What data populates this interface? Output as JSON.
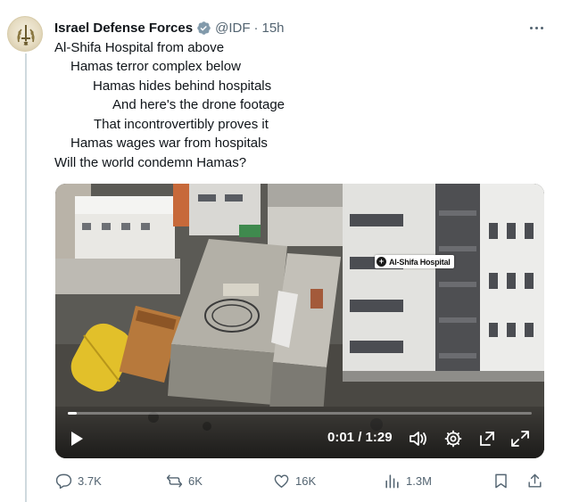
{
  "author": {
    "name": "Israel Defense Forces",
    "handle": "@IDF",
    "separator": "·",
    "time": "15h",
    "verified_color": "#829aab"
  },
  "post": {
    "lines": [
      "Al-Shifa Hospital from above",
      "Hamas terror complex below",
      "Hamas hides behind hospitals",
      "And here's the drone footage",
      "That incontrovertibly proves it",
      "Hamas wages war from hospitals",
      "Will the world condemn Hamas?"
    ]
  },
  "video": {
    "location_tag": "Al-Shifa Hospital",
    "current_time": "0:01",
    "duration": "1:29",
    "time_display": "0:01 / 1:29",
    "progress": 0.01,
    "icons": [
      "play-icon",
      "volume-icon",
      "settings-icon",
      "pop-out-icon",
      "fullscreen-icon"
    ]
  },
  "actions": {
    "replies": "3.7K",
    "reposts": "6K",
    "likes": "16K",
    "views": "1.3M"
  },
  "colors": {
    "text_primary": "#0f1419",
    "text_secondary": "#536471",
    "divider": "#cfd9de"
  }
}
